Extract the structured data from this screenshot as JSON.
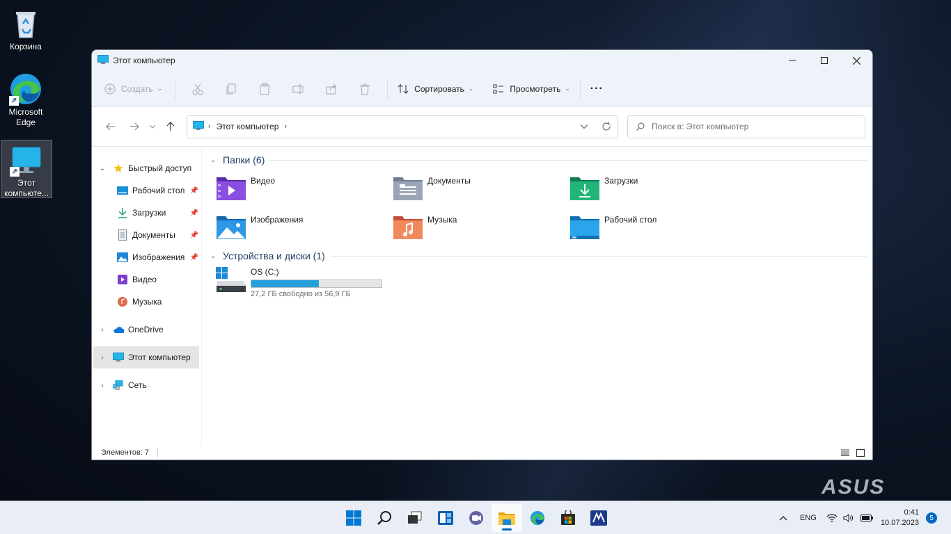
{
  "desktop": {
    "icons": [
      {
        "label": "Корзина"
      },
      {
        "label": "Microsoft Edge"
      },
      {
        "label": "Этот компьюте..."
      }
    ],
    "brand": "ASUS"
  },
  "window": {
    "title": "Этот компьютер",
    "toolbar": {
      "create_label": "Создать",
      "sort_label": "Сортировать",
      "view_label": "Просмотреть",
      "more_label": "···"
    },
    "address": {
      "crumb": "Этот компьютер"
    },
    "search": {
      "placeholder": "Поиск в: Этот компьютер"
    },
    "nav_pane": {
      "quick_access": "Быстрый доступ",
      "quick_items": [
        {
          "label": "Рабочий стол"
        },
        {
          "label": "Загрузки"
        },
        {
          "label": "Документы"
        },
        {
          "label": "Изображения"
        },
        {
          "label": "Видео"
        },
        {
          "label": "Музыка"
        }
      ],
      "onedrive": "OneDrive",
      "this_pc": "Этот компьютер",
      "network": "Сеть"
    },
    "content": {
      "folders_header": "Папки (6)",
      "folders": [
        {
          "name": "Видео",
          "color": "#7b3fd0"
        },
        {
          "name": "Документы",
          "color": "#7d8a9c"
        },
        {
          "name": "Загрузки",
          "color": "#1aa36b"
        },
        {
          "name": "Изображения",
          "color": "#1e88d8"
        },
        {
          "name": "Музыка",
          "color": "#e06a4a"
        },
        {
          "name": "Рабочий стол",
          "color": "#1b8fd6"
        }
      ],
      "drives_header": "Устройства и диски (1)",
      "drive": {
        "name": "OS (C:)",
        "free_text": "27,2 ГБ свободно из 56,9 ГБ",
        "used_fraction": 0.52
      }
    },
    "statusbar": {
      "count": "Элементов: 7"
    }
  },
  "taskbar": {
    "lang": "ENG",
    "time": "0:41",
    "date": "10.07.2023",
    "notifications": "5",
    "accent": "#0067c0"
  }
}
